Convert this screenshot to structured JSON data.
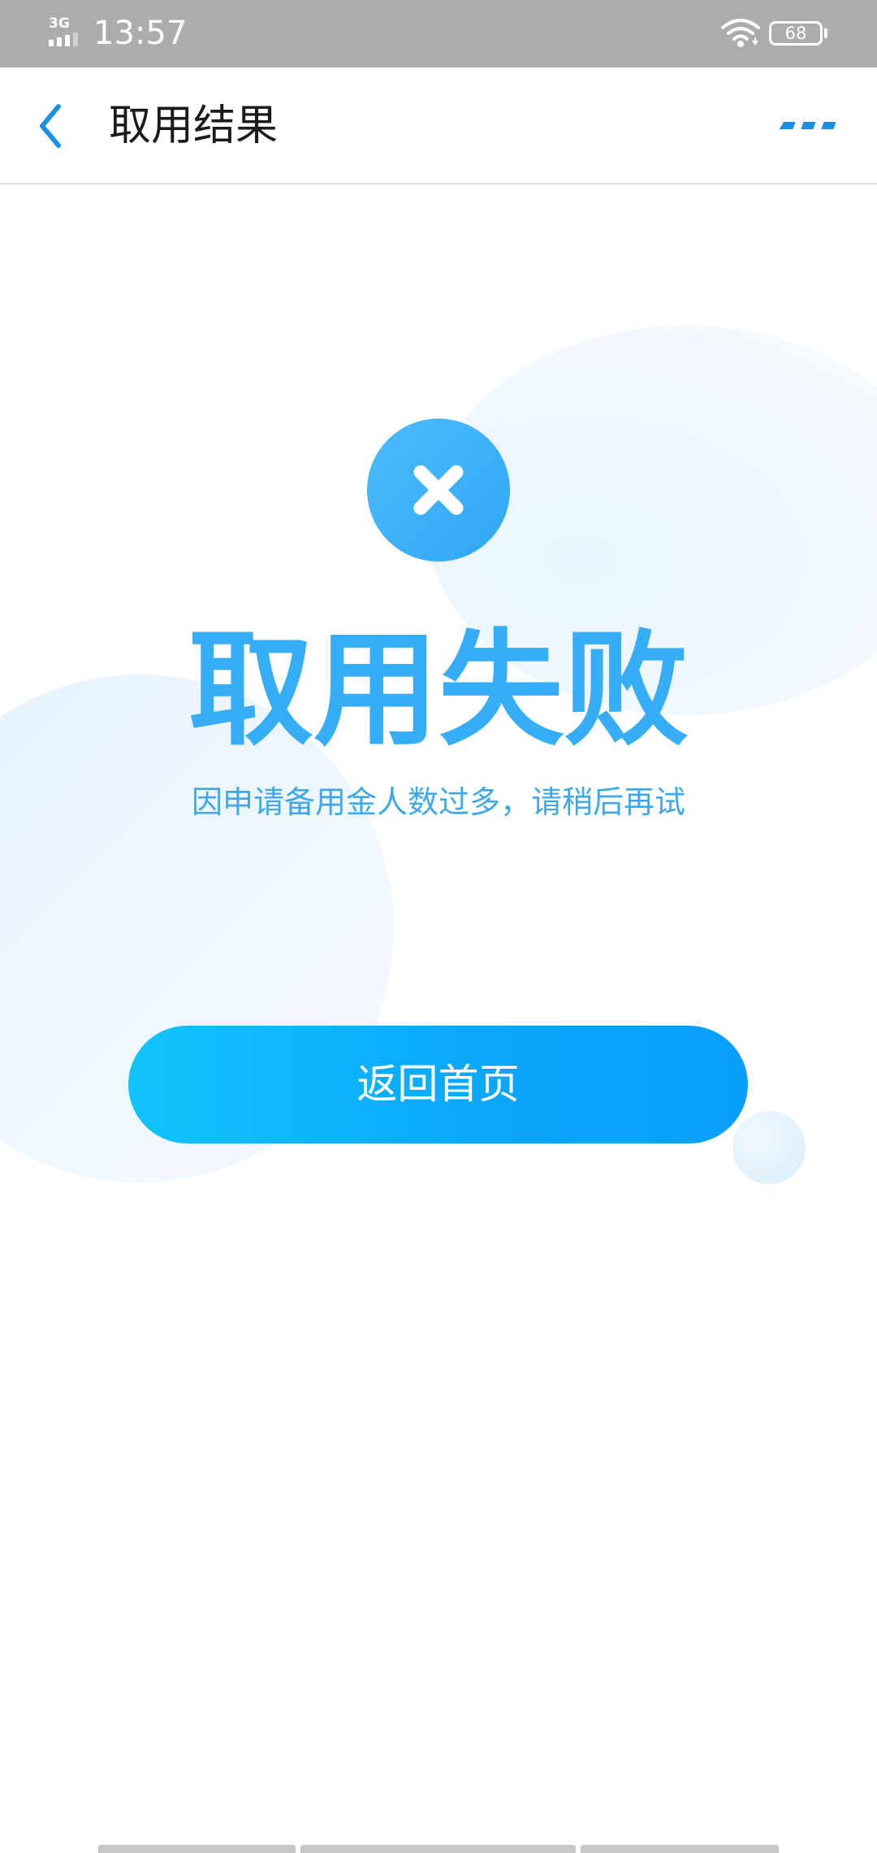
{
  "status_bar": {
    "network": "3G",
    "time": "13:57",
    "battery": "68",
    "icons": [
      "signal-icon",
      "wifi-icon",
      "battery-icon"
    ]
  },
  "nav": {
    "title": "取用结果",
    "back_icon": "chevron-left-icon",
    "more_icon": "more-dots-icon"
  },
  "result": {
    "icon": "close-icon",
    "title": "取用失败",
    "message": "因申请备用金人数过多，请稍后再试"
  },
  "actions": {
    "home_button": "返回首页"
  },
  "colors": {
    "accent": "#35aef7",
    "button_start": "#12c4fd",
    "button_end": "#0a9efc",
    "status_bar": "#acacac",
    "icon_blue": "#1a8fe3"
  }
}
